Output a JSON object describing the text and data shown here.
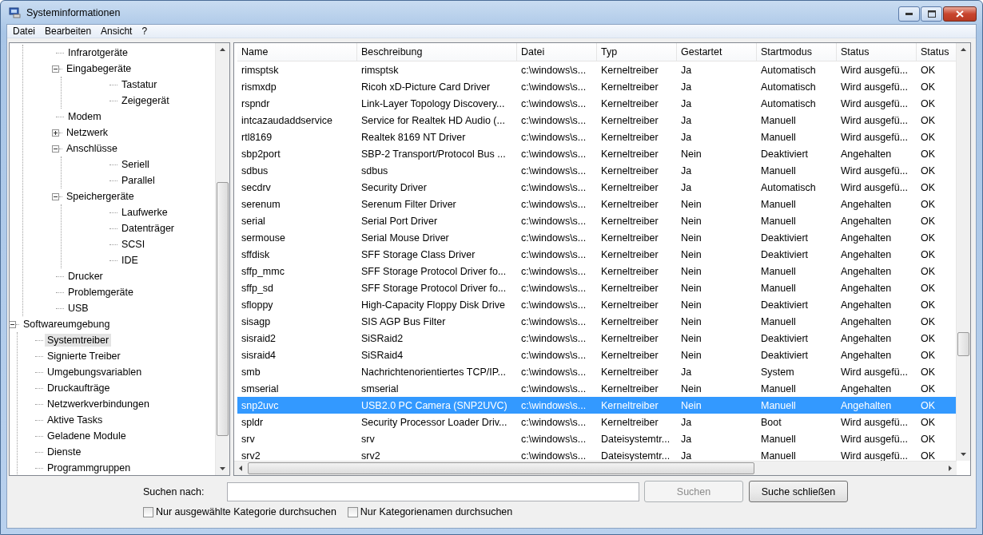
{
  "window": {
    "title": "Systeminformationen"
  },
  "menu": [
    "Datei",
    "Bearbeiten",
    "Ansicht",
    "?"
  ],
  "tree": {
    "items": [
      {
        "children": [
          {
            "label": "Infrarotgeräte",
            "selected": false
          },
          {
            "label": "Eingabegeräte",
            "selected": false,
            "expanded": true,
            "children": [
              {
                "label": "Tastatur",
                "selected": false
              },
              {
                "label": "Zeigegerät",
                "selected": false
              }
            ]
          },
          {
            "label": "Modem",
            "selected": false
          },
          {
            "label": "Netzwerk",
            "selected": false,
            "expanded": false
          },
          {
            "label": "Anschlüsse",
            "selected": false,
            "expanded": true,
            "children": [
              {
                "label": "Seriell",
                "selected": false
              },
              {
                "label": "Parallel",
                "selected": false
              }
            ]
          },
          {
            "label": "Speichergeräte",
            "selected": false,
            "expanded": true,
            "children": [
              {
                "label": "Laufwerke",
                "selected": false
              },
              {
                "label": "Datenträger",
                "selected": false
              },
              {
                "label": "SCSI",
                "selected": false
              },
              {
                "label": "IDE",
                "selected": false
              }
            ]
          },
          {
            "label": "Drucker",
            "selected": false
          },
          {
            "label": "Problemgeräte",
            "selected": false
          },
          {
            "label": "USB",
            "selected": false
          }
        ]
      },
      {
        "label": "Softwareumgebung",
        "selected": false,
        "expanded": true,
        "children": [
          {
            "label": "Systemtreiber",
            "selected": true
          },
          {
            "label": "Signierte Treiber",
            "selected": false
          },
          {
            "label": "Umgebungsvariablen",
            "selected": false
          },
          {
            "label": "Druckaufträge",
            "selected": false
          },
          {
            "label": "Netzwerkverbindungen",
            "selected": false
          },
          {
            "label": "Aktive Tasks",
            "selected": false
          },
          {
            "label": "Geladene Module",
            "selected": false
          },
          {
            "label": "Dienste",
            "selected": false
          },
          {
            "label": "Programmgruppen",
            "selected": false
          }
        ]
      }
    ]
  },
  "table": {
    "columns": [
      "Name",
      "Beschreibung",
      "Datei",
      "Typ",
      "Gestartet",
      "Startmodus",
      "Status",
      "Status"
    ],
    "rows": [
      {
        "selected": false,
        "cells": [
          "rimsptsk",
          "rimsptsk",
          "c:\\windows\\s...",
          "Kerneltreiber",
          "Ja",
          "Automatisch",
          "Wird ausgefü...",
          "OK"
        ]
      },
      {
        "selected": false,
        "cells": [
          "rismxdp",
          "Ricoh xD-Picture Card Driver",
          "c:\\windows\\s...",
          "Kerneltreiber",
          "Ja",
          "Automatisch",
          "Wird ausgefü...",
          "OK"
        ]
      },
      {
        "selected": false,
        "cells": [
          "rspndr",
          "Link-Layer Topology Discovery...",
          "c:\\windows\\s...",
          "Kerneltreiber",
          "Ja",
          "Automatisch",
          "Wird ausgefü...",
          "OK"
        ]
      },
      {
        "selected": false,
        "cells": [
          "intcazaudaddservice",
          "Service for Realtek HD Audio (...",
          "c:\\windows\\s...",
          "Kerneltreiber",
          "Ja",
          "Manuell",
          "Wird ausgefü...",
          "OK"
        ]
      },
      {
        "selected": false,
        "cells": [
          "rtl8169",
          "Realtek 8169 NT Driver",
          "c:\\windows\\s...",
          "Kerneltreiber",
          "Ja",
          "Manuell",
          "Wird ausgefü...",
          "OK"
        ]
      },
      {
        "selected": false,
        "cells": [
          "sbp2port",
          "SBP-2 Transport/Protocol Bus ...",
          "c:\\windows\\s...",
          "Kerneltreiber",
          "Nein",
          "Deaktiviert",
          "Angehalten",
          "OK"
        ]
      },
      {
        "selected": false,
        "cells": [
          "sdbus",
          "sdbus",
          "c:\\windows\\s...",
          "Kerneltreiber",
          "Ja",
          "Manuell",
          "Wird ausgefü...",
          "OK"
        ]
      },
      {
        "selected": false,
        "cells": [
          "secdrv",
          "Security Driver",
          "c:\\windows\\s...",
          "Kerneltreiber",
          "Ja",
          "Automatisch",
          "Wird ausgefü...",
          "OK"
        ]
      },
      {
        "selected": false,
        "cells": [
          "serenum",
          "Serenum Filter Driver",
          "c:\\windows\\s...",
          "Kerneltreiber",
          "Nein",
          "Manuell",
          "Angehalten",
          "OK"
        ]
      },
      {
        "selected": false,
        "cells": [
          "serial",
          "Serial Port Driver",
          "c:\\windows\\s...",
          "Kerneltreiber",
          "Nein",
          "Manuell",
          "Angehalten",
          "OK"
        ]
      },
      {
        "selected": false,
        "cells": [
          "sermouse",
          "Serial Mouse Driver",
          "c:\\windows\\s...",
          "Kerneltreiber",
          "Nein",
          "Deaktiviert",
          "Angehalten",
          "OK"
        ]
      },
      {
        "selected": false,
        "cells": [
          "sffdisk",
          "SFF Storage Class Driver",
          "c:\\windows\\s...",
          "Kerneltreiber",
          "Nein",
          "Deaktiviert",
          "Angehalten",
          "OK"
        ]
      },
      {
        "selected": false,
        "cells": [
          "sffp_mmc",
          "SFF Storage Protocol Driver fo...",
          "c:\\windows\\s...",
          "Kerneltreiber",
          "Nein",
          "Manuell",
          "Angehalten",
          "OK"
        ]
      },
      {
        "selected": false,
        "cells": [
          "sffp_sd",
          "SFF Storage Protocol Driver fo...",
          "c:\\windows\\s...",
          "Kerneltreiber",
          "Nein",
          "Manuell",
          "Angehalten",
          "OK"
        ]
      },
      {
        "selected": false,
        "cells": [
          "sfloppy",
          "High-Capacity Floppy Disk Drive",
          "c:\\windows\\s...",
          "Kerneltreiber",
          "Nein",
          "Deaktiviert",
          "Angehalten",
          "OK"
        ]
      },
      {
        "selected": false,
        "cells": [
          "sisagp",
          "SIS AGP Bus Filter",
          "c:\\windows\\s...",
          "Kerneltreiber",
          "Nein",
          "Manuell",
          "Angehalten",
          "OK"
        ]
      },
      {
        "selected": false,
        "cells": [
          "sisraid2",
          "SiSRaid2",
          "c:\\windows\\s...",
          "Kerneltreiber",
          "Nein",
          "Deaktiviert",
          "Angehalten",
          "OK"
        ]
      },
      {
        "selected": false,
        "cells": [
          "sisraid4",
          "SiSRaid4",
          "c:\\windows\\s...",
          "Kerneltreiber",
          "Nein",
          "Deaktiviert",
          "Angehalten",
          "OK"
        ]
      },
      {
        "selected": false,
        "cells": [
          "smb",
          "Nachrichtenorientiertes TCP/IP...",
          "c:\\windows\\s...",
          "Kerneltreiber",
          "Ja",
          "System",
          "Wird ausgefü...",
          "OK"
        ]
      },
      {
        "selected": false,
        "cells": [
          "smserial",
          "smserial",
          "c:\\windows\\s...",
          "Kerneltreiber",
          "Nein",
          "Manuell",
          "Angehalten",
          "OK"
        ]
      },
      {
        "selected": true,
        "cells": [
          "snp2uvc",
          "USB2.0 PC Camera (SNP2UVC)",
          "c:\\windows\\s...",
          "Kerneltreiber",
          "Nein",
          "Manuell",
          "Angehalten",
          "OK"
        ]
      },
      {
        "selected": false,
        "cells": [
          "spldr",
          "Security Processor Loader Driv...",
          "c:\\windows\\s...",
          "Kerneltreiber",
          "Ja",
          "Boot",
          "Wird ausgefü...",
          "OK"
        ]
      },
      {
        "selected": false,
        "cells": [
          "srv",
          "srv",
          "c:\\windows\\s...",
          "Dateisystemtr...",
          "Ja",
          "Manuell",
          "Wird ausgefü...",
          "OK"
        ]
      },
      {
        "selected": false,
        "cells": [
          "srv2",
          "srv2",
          "c:\\windows\\s...",
          "Dateisystemtr...",
          "Ja",
          "Manuell",
          "Wird ausgefü...",
          "OK"
        ]
      }
    ]
  },
  "search": {
    "label": "Suchen nach:",
    "search_button": {
      "label": "Suchen",
      "disabled": true
    },
    "close_button": {
      "label": "Suche schließen",
      "disabled": false
    },
    "options": [
      {
        "label": "Nur ausgewählte Kategorie durchsuchen",
        "checked": false
      },
      {
        "label": "Nur Kategorienamen durchsuchen",
        "checked": false
      }
    ]
  }
}
